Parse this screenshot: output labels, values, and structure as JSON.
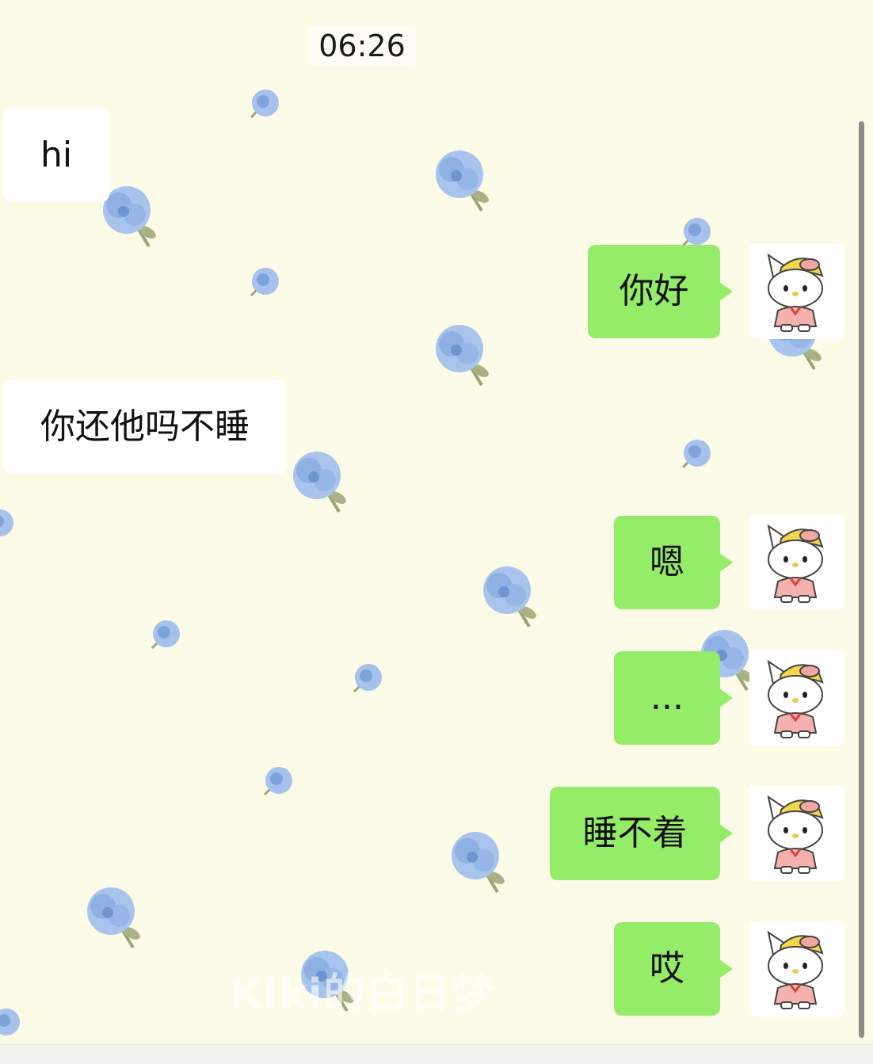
{
  "chat": {
    "timestamp": "06:26",
    "messages": [
      {
        "side": "in",
        "text": "hi"
      },
      {
        "side": "out",
        "text": "你好"
      },
      {
        "side": "in",
        "text": "你还他吗不睡"
      },
      {
        "side": "out",
        "text": "嗯"
      },
      {
        "side": "out",
        "text": "..."
      },
      {
        "side": "out",
        "text": "睡不着"
      },
      {
        "side": "out",
        "text": "哎"
      }
    ]
  },
  "watermark": "Kiki的白日梦",
  "avatar": {
    "icon": "hello-kitty-icon"
  },
  "colors": {
    "background": "#fbfbe8",
    "incoming_bubble": "#ffffff",
    "outgoing_bubble": "#95ec69",
    "flower": "#8fb4e4",
    "leaf": "#9aa47a"
  }
}
